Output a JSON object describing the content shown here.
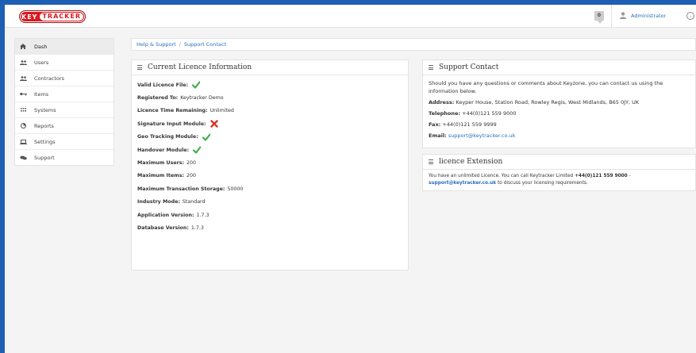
{
  "header": {
    "logo_key": "KEY",
    "logo_tracker": "TRACKER",
    "notification_count": "0",
    "user_name": "Administrator"
  },
  "sidebar": {
    "items": [
      {
        "label": "Dash",
        "icon": "home-icon",
        "active": true
      },
      {
        "label": "Users",
        "icon": "users-icon"
      },
      {
        "label": "Contractors",
        "icon": "contractors-icon"
      },
      {
        "label": "Items",
        "icon": "key-icon"
      },
      {
        "label": "Systems",
        "icon": "grid-icon"
      },
      {
        "label": "Reports",
        "icon": "pie-chart-icon"
      },
      {
        "label": "Settings",
        "icon": "laptop-icon"
      },
      {
        "label": "Support",
        "icon": "chat-icon"
      }
    ]
  },
  "breadcrumb": {
    "items": [
      "Help & Support",
      "Support Contact"
    ],
    "separator": "/"
  },
  "licence": {
    "title": "Current Licence Information",
    "rows": [
      {
        "label": "Valid Licence File:",
        "value": "",
        "status": "check"
      },
      {
        "label": "Registered To:",
        "value": "Keytracker Demo"
      },
      {
        "label": "Licence Time Remaining:",
        "value": "Unlimited"
      },
      {
        "label": "Signature Input Module:",
        "value": "",
        "status": "cross"
      },
      {
        "label": "Geo Tracking Module:",
        "value": "",
        "status": "check"
      },
      {
        "label": "Handover Module:",
        "value": "",
        "status": "check"
      },
      {
        "label": "Maximum Users:",
        "value": "200"
      },
      {
        "label": "Maximum Items:",
        "value": "200"
      },
      {
        "label": "Maximum Transaction Storage:",
        "value": "50000"
      },
      {
        "label": "Industry Mode:",
        "value": "Standard"
      },
      {
        "label": "Application Version:",
        "value": "1.7.3"
      },
      {
        "label": "Database Version:",
        "value": "1.7.3"
      }
    ]
  },
  "support": {
    "title": "Support Contact",
    "intro": "Should you have any questions or comments about Keyzone, you can contact us using the information below.",
    "address_label": "Address:",
    "address": "Keyper House, Station Road, Rowley Regis, West Midlands, B65 0JY, UK",
    "telephone_label": "Telephone:",
    "telephone": "+44(0)121 559 9000",
    "fax_label": "Fax:",
    "fax": "+44(0)121 559 9999",
    "email_label": "Email:",
    "email": "support@keytracker.co.uk"
  },
  "extension": {
    "title": "licence Extension",
    "text_before": "You have an unlimited Licence. You can call Keytracker Limited ",
    "phone": "+44(0)121 559 9000",
    "text_dash": " - ",
    "email": "support@keytracker.co.uk",
    "text_after": " to discuss your licensing requirements."
  },
  "colors": {
    "background": "#1c5fb3",
    "link": "#2a6ebb",
    "check": "#3fae49",
    "cross": "#d9342b",
    "logo": "#d71920"
  }
}
